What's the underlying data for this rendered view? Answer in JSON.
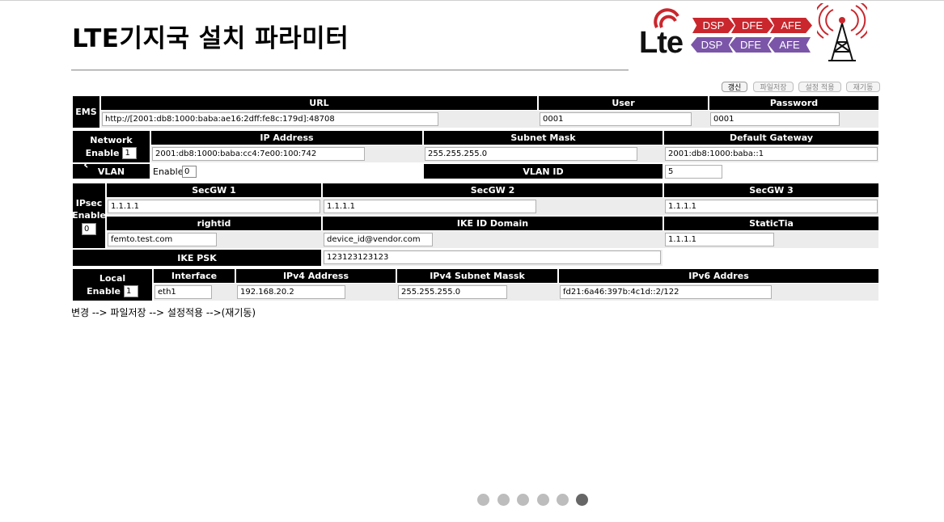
{
  "page": {
    "title": "LTE기지국 설치 파라미터"
  },
  "logo": {
    "wordmark": "Lte",
    "top_row": [
      "DSP",
      "DFE",
      "AFE"
    ],
    "bottom_row": [
      "DSP",
      "DFE",
      "AFE"
    ],
    "colors": {
      "red": "#c9272d",
      "purple": "#7b56a8"
    }
  },
  "toolbar": {
    "refresh": "갱신",
    "save_file": "파일저장",
    "apply_settings": "설정 적용",
    "reboot": "재기동"
  },
  "ems": {
    "label": "EMS",
    "url_header": "URL",
    "user_header": "User",
    "password_header": "Password",
    "url": "http://[2001:db8:1000:baba:ae16:2dff:fe8c:179d]:48708",
    "user": "0001",
    "password": "0001"
  },
  "network": {
    "label": "Network",
    "enable_label": "Enable",
    "enable_value": "1",
    "ip_header": "IP Address",
    "subnet_header": "Subnet Mask",
    "gateway_header": "Default Gateway",
    "ip": "2001:db8:1000:baba:cc4:7e00:100:742",
    "subnet": "255.255.255.0",
    "gateway": "2001:db8:1000:baba::1"
  },
  "vlan": {
    "label": "VLAN",
    "enable_label": "Enable",
    "enable_value": "0",
    "id_header": "VLAN ID",
    "id": "5"
  },
  "ipsec": {
    "label": "IPsec",
    "enable_label": "Enable",
    "enable_value": "0",
    "secgw1_header": "SecGW 1",
    "secgw2_header": "SecGW 2",
    "secgw3_header": "SecGW 3",
    "secgw1": "1.1.1.1",
    "secgw2": "1.1.1.1",
    "secgw3": "1.1.1.1",
    "rightid_header": "rightid",
    "ike_domain_header": "IKE ID Domain",
    "statictia_header": "StaticTia",
    "rightid": "femto.test.com",
    "ike_domain": "device_id@vendor.com",
    "statictia": "1.1.1.1",
    "ike_psk_label": "IKE PSK",
    "ike_psk": "123123123123"
  },
  "local": {
    "label": "Local",
    "enable_label": "Enable",
    "enable_value": "1",
    "interface_header": "Interface",
    "ipv4_header": "IPv4 Address",
    "ipv4_mask_header": "IPv4 Subnet Massk",
    "ipv6_header": "IPv6 Addres",
    "interface": "eth1",
    "ipv4": "192.168.20.2",
    "ipv4_mask": "255.255.255.0",
    "ipv6": "fd21:6a46:397b:4c1d::2/122"
  },
  "instructions": "변경 --> 파일저장 --> 설정적용 -->(재기동)",
  "pagination": {
    "total": 6,
    "active": 6
  }
}
